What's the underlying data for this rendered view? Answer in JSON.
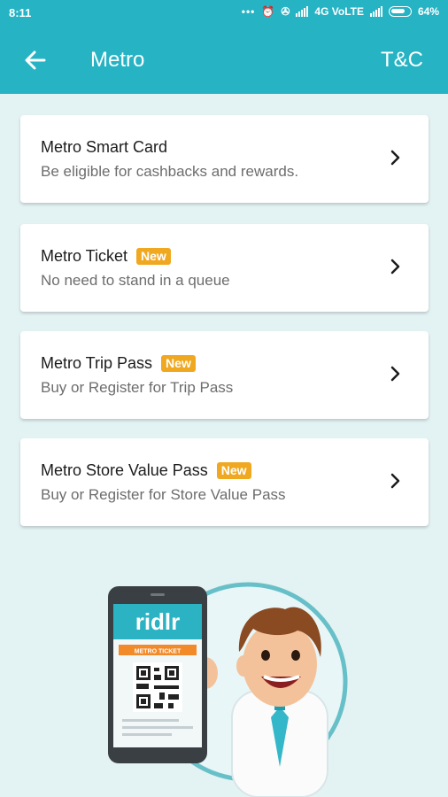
{
  "status_bar": {
    "time": "8:11",
    "network": "4G VoLTE",
    "battery": "64%"
  },
  "app_bar": {
    "title": "Metro",
    "action": "T&C"
  },
  "cards": [
    {
      "title": "Metro Smart Card",
      "subtitle": "Be eligible for cashbacks and rewards.",
      "badge": ""
    },
    {
      "title": "Metro Ticket",
      "subtitle": "No need to stand in a queue",
      "badge": "New"
    },
    {
      "title": "Metro Trip Pass",
      "subtitle": "Buy or Register for Trip Pass",
      "badge": "New"
    },
    {
      "title": "Metro Store Value Pass",
      "subtitle": "Buy or Register for Store Value Pass",
      "badge": "New"
    }
  ],
  "illustration": {
    "brand": "ridlr",
    "ticket_label": "METRO TICKET"
  },
  "colors": {
    "primary": "#26b3c4",
    "background": "#e3f2f3",
    "badge": "#f0a820"
  }
}
